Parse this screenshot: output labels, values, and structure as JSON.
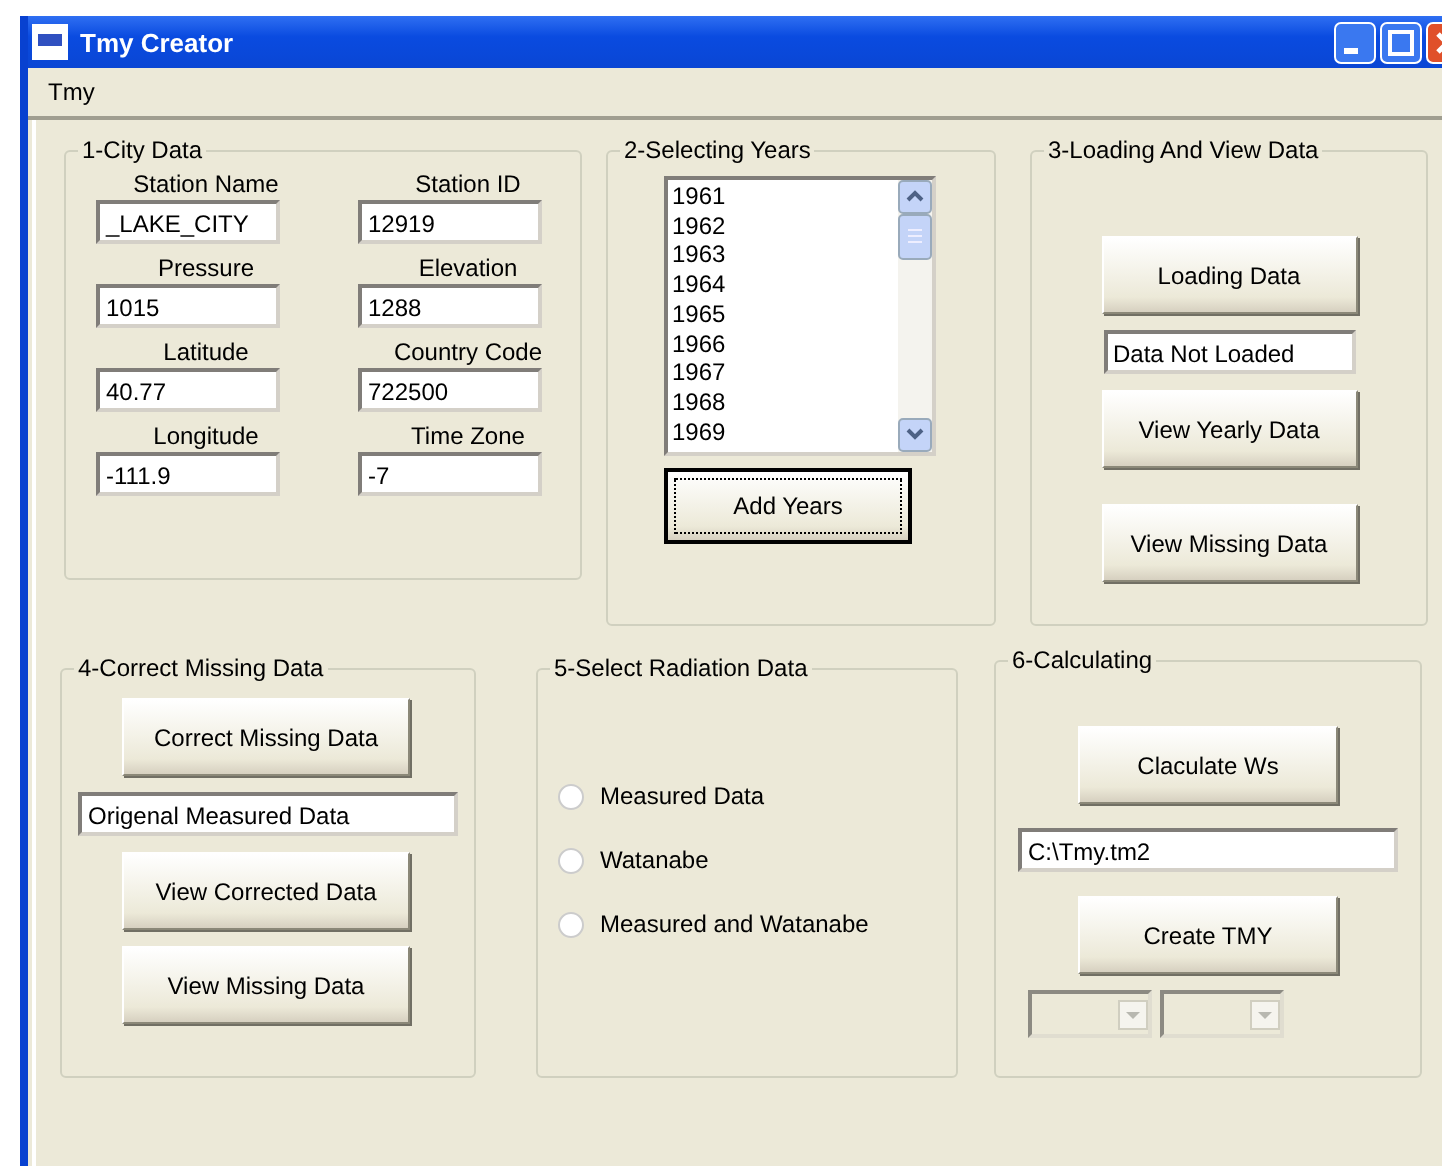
{
  "window": {
    "title": "Tmy Creator"
  },
  "menu": [
    "Tmy"
  ],
  "city_data": {
    "title": "1-City Data",
    "fields": [
      {
        "label": "Station Name",
        "value": "_LAKE_CITY"
      },
      {
        "label": "Station ID",
        "value": "12919"
      },
      {
        "label": "Pressure",
        "value": "1015"
      },
      {
        "label": "Elevation",
        "value": "1288"
      },
      {
        "label": "Latitude",
        "value": "40.77"
      },
      {
        "label": "Country Code",
        "value": "722500"
      },
      {
        "label": "Longitude",
        "value": "-111.9"
      },
      {
        "label": "Time Zone",
        "value": "-7"
      }
    ]
  },
  "selecting_years": {
    "title": "2-Selecting Years",
    "years": [
      {
        "label": "1961",
        "selected": false
      },
      {
        "label": "1962",
        "selected": false
      },
      {
        "label": "1963",
        "selected": false
      },
      {
        "label": "1964",
        "selected": false
      },
      {
        "label": "1965",
        "selected": false
      },
      {
        "label": "1966",
        "selected": false
      },
      {
        "label": "1967",
        "selected": false
      },
      {
        "label": "1968",
        "selected": false
      },
      {
        "label": "1969",
        "selected": false
      }
    ],
    "button": {
      "label": "Add Years",
      "focused": true
    }
  },
  "loading": {
    "title": "3-Loading And View Data",
    "items": [
      {
        "kind": "button",
        "label": "Loading Data"
      },
      {
        "kind": "field",
        "value": "Data Not Loaded"
      },
      {
        "kind": "button",
        "label": "View Yearly Data"
      },
      {
        "kind": "button",
        "label": "View Missing Data"
      }
    ]
  },
  "correct": {
    "title": "4-Correct Missing Data",
    "items": [
      {
        "kind": "button",
        "label": "Correct Missing Data"
      },
      {
        "kind": "field",
        "value": "Origenal Measured Data"
      },
      {
        "kind": "button",
        "label": "View Corrected Data"
      },
      {
        "kind": "button",
        "label": "View Missing Data"
      }
    ]
  },
  "radiation": {
    "title": "5-Select Radiation Data",
    "options": [
      {
        "label": "Measured Data",
        "selected": false
      },
      {
        "label": "Watanabe",
        "selected": false
      },
      {
        "label": "Measured and Watanabe",
        "selected": false
      }
    ]
  },
  "calculating": {
    "title": "6-Calculating",
    "items": [
      {
        "kind": "button",
        "label": "Claculate Ws"
      },
      {
        "kind": "field",
        "value": "C:\\Tmy.tm2"
      },
      {
        "kind": "button",
        "label": "Create TMY"
      },
      {
        "kind": "combo"
      },
      {
        "kind": "combo"
      }
    ]
  }
}
